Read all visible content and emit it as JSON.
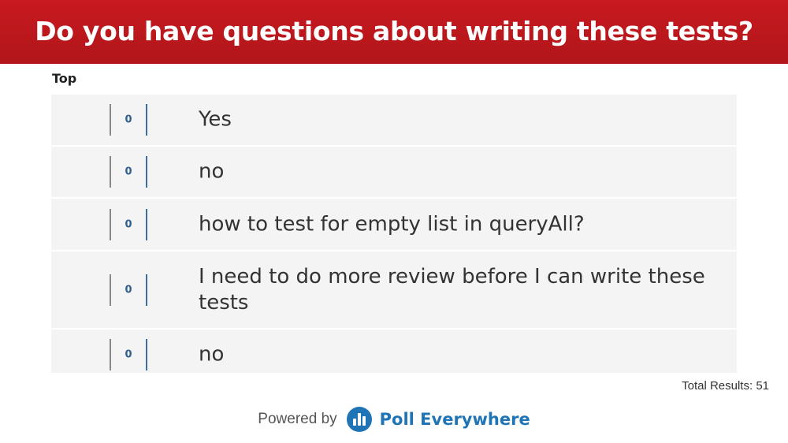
{
  "header": {
    "title": "Do you have questions about writing these tests?"
  },
  "sort": {
    "label": "Top"
  },
  "responses": [
    {
      "votes": "0",
      "text": "Yes"
    },
    {
      "votes": "0",
      "text": "no"
    },
    {
      "votes": "0",
      "text": "how to test for empty list in queryAll?"
    },
    {
      "votes": "0",
      "text": "I need to do more review before I can write these tests"
    },
    {
      "votes": "0",
      "text": "no"
    }
  ],
  "summary": {
    "total": "Total Results: 51"
  },
  "footer": {
    "powered_by": "Powered by",
    "brand": "Poll Everywhere",
    "icon": "poll-everywhere-logo-icon"
  },
  "colors": {
    "header": "#c8191f",
    "accent": "#1f74b6",
    "row_bg": "#f4f4f4"
  }
}
